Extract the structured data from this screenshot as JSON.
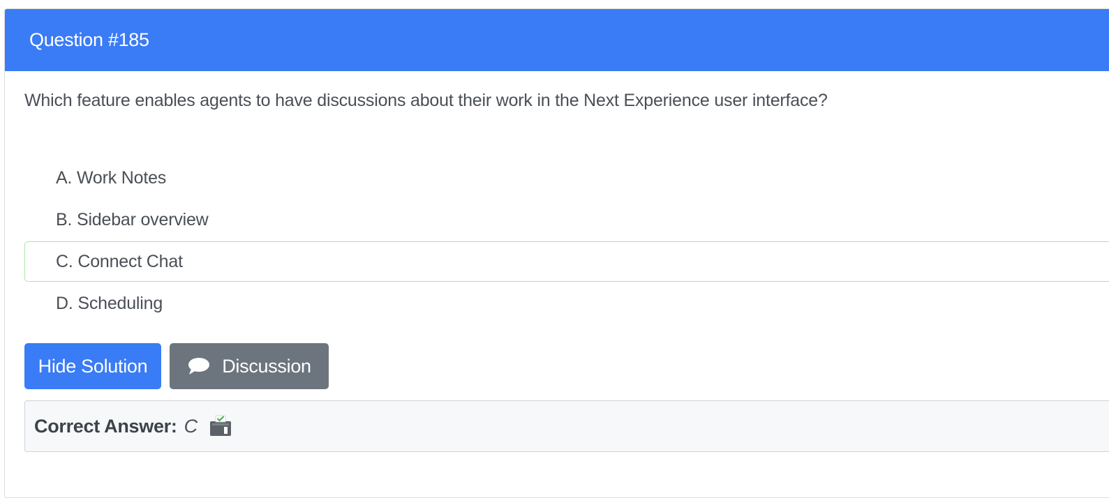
{
  "header": {
    "title": "Question #185",
    "color": "#3a7bf6"
  },
  "question": {
    "text": "Which feature enables agents to have discussions about their work in the Next Experience user interface?"
  },
  "choices": [
    {
      "label": "A. Work Notes",
      "correct": false
    },
    {
      "label": "B. Sidebar overview",
      "correct": false
    },
    {
      "label": "C. Connect Chat",
      "correct": true
    },
    {
      "label": "D. Scheduling",
      "correct": false
    }
  ],
  "actions": {
    "hide_solution_label": "Hide Solution",
    "discussion_label": "Discussion",
    "discussion_icon": "chat-bubble-icon"
  },
  "answer": {
    "label": "Correct Answer:",
    "value": "C",
    "icon": "vote-box-icon"
  },
  "colors": {
    "primary": "#3a7bf6",
    "secondary": "#6c757d",
    "correct_border": "#a8e6a0"
  }
}
